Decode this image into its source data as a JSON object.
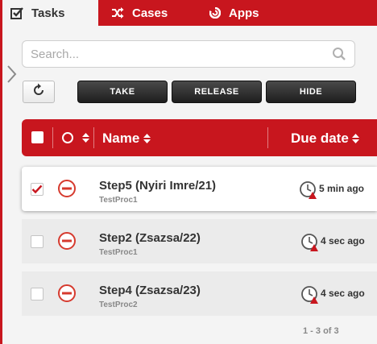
{
  "tabs": [
    {
      "label": "Tasks",
      "icon": "checkbox-icon",
      "active": true
    },
    {
      "label": "Cases",
      "icon": "shuffle-icon",
      "active": false
    },
    {
      "label": "Apps",
      "icon": "apps-icon",
      "active": false
    }
  ],
  "search": {
    "placeholder": "Search...",
    "value": ""
  },
  "actions": {
    "take": "TAKE",
    "release": "RELEASE",
    "hide": "HIDE"
  },
  "table": {
    "headers": {
      "name": "Name",
      "due": "Due date"
    },
    "rows": [
      {
        "name": "Step5 (Nyiri Imre/21)",
        "process": "TestProc1",
        "due": "5 min ago",
        "checked": true
      },
      {
        "name": "Step2 (Zsazsa/22)",
        "process": "TestProc1",
        "due": "4 sec ago",
        "checked": false
      },
      {
        "name": "Step4 (Zsazsa/23)",
        "process": "TestProc2",
        "due": "4 sec ago",
        "checked": false
      }
    ]
  },
  "pagination": "1 - 3 of 3",
  "colors": {
    "brand": "#c8161e",
    "button_dark": "#2a2a2a",
    "row_bg": "#ebebeb",
    "muted_text": "#888888"
  }
}
